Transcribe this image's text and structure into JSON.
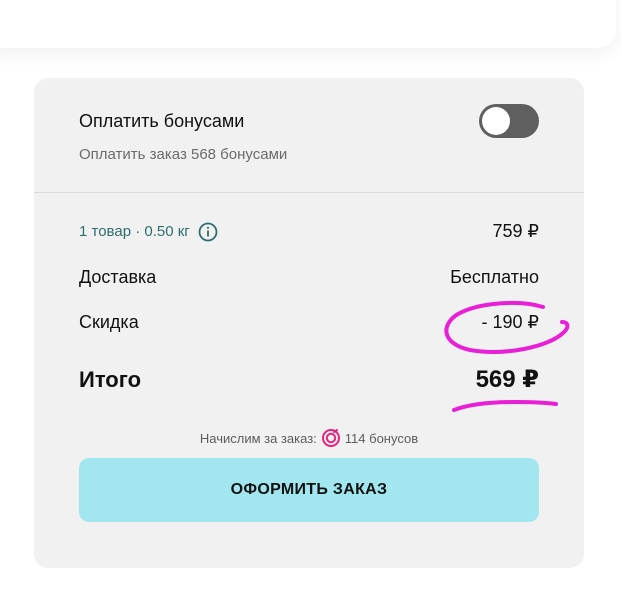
{
  "bonus": {
    "title": "Оплатить бонусами",
    "subtitle": "Оплатить заказ 568 бонусами",
    "toggle_on": false
  },
  "summary": {
    "items_label": "1 товар · 0.50 кг",
    "items_value": "759 ₽",
    "delivery_label": "Доставка",
    "delivery_value": "Бесплатно",
    "discount_label": "Скидка",
    "discount_value": "- 190 ₽",
    "total_label": "Итого",
    "total_value": "569 ₽"
  },
  "accrual": {
    "prefix": "Начислим за заказ:",
    "amount": "114 бонусов"
  },
  "order_button": {
    "label": "ОФОРМИТЬ ЗАКАЗ"
  },
  "colors": {
    "card_bg": "#f1f1f1",
    "button_bg": "#a2e6ef",
    "toggle_off": "#5f5f5f",
    "accent_teal": "#2f6d6d",
    "bonus_icon": "#e6247f",
    "annotation": "#e81fd6"
  },
  "icons": {
    "info": "info-circle-icon",
    "bonus": "bonus-coin-icon"
  }
}
